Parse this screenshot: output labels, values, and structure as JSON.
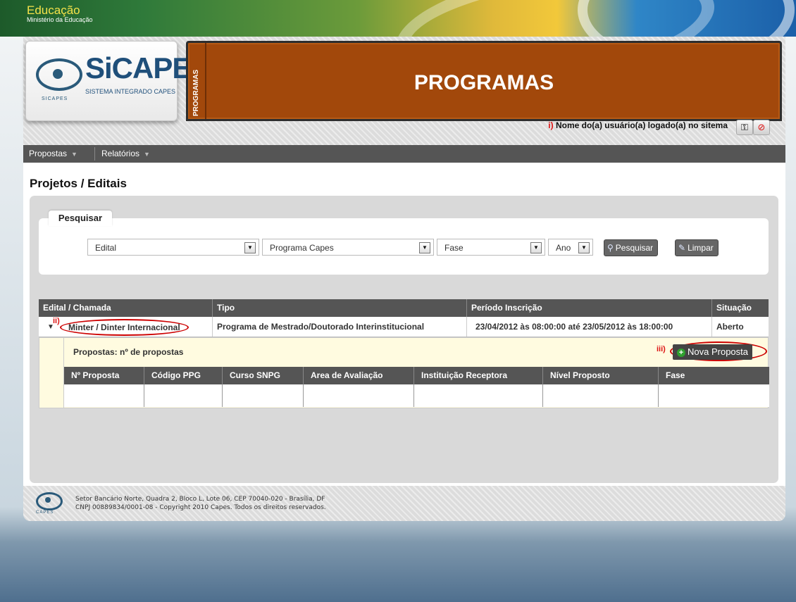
{
  "gov": {
    "title": "Educação",
    "subtitle": "Ministério da Educação"
  },
  "logo": {
    "name": "SiCAPES",
    "sub": "SISTEMA INTEGRADO CAPES",
    "small": "SICAPES"
  },
  "banner": {
    "side": "PROGRAMAS",
    "title": "PROGRAMAS"
  },
  "user": {
    "marker": "i)",
    "text": "Nome do(a) usuário(a) logado(a) no sitema"
  },
  "menu": {
    "items": [
      {
        "label": "Propostas"
      },
      {
        "label": "Relatórios"
      }
    ]
  },
  "page": {
    "title": "Projetos / Editais"
  },
  "search": {
    "tab_label": "Pesquisar",
    "edital": "Edital",
    "programa": "Programa Capes",
    "fase": "Fase",
    "ano": "Ano",
    "search_button": "Pesquisar",
    "clear_button": "Limpar"
  },
  "table": {
    "headers": [
      "Edital / Chamada",
      "Tipo",
      "Período Inscrição",
      "Situação"
    ],
    "row": {
      "marker": "ii)",
      "edital": "Minter / Dinter Internacional",
      "tipo": "Programa de Mestrado/Doutorado Interinstitucional",
      "periodo": "23/04/2012 às 08:00:00 até 23/05/2012 às 18:00:00",
      "situacao": "Aberto"
    }
  },
  "propostas": {
    "label": "Propostas:",
    "count": "nº de propostas",
    "marker": "iii)",
    "new_button": "Nova Proposta",
    "headers": [
      "Nº Proposta",
      "Código PPG",
      "Curso SNPG",
      "Area de Avaliação",
      "Instituição Receptora",
      "Nível Proposto",
      "Fase"
    ]
  },
  "footer": {
    "line1": "Setor Bancário Norte, Quadra 2, Bloco L, Lote 06, CEP 70040-020 - Brasília, DF",
    "line2": "CNPJ 00889834/0001-08 - Copyright 2010 Capes. Todos os direitos reservados.",
    "logo_text": "CAPES"
  }
}
